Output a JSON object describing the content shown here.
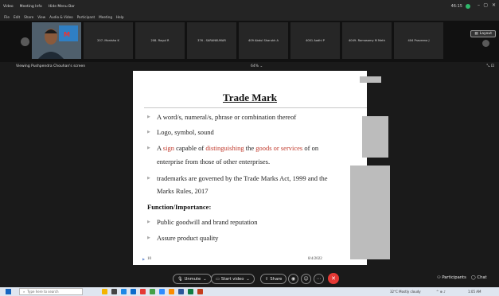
{
  "titlebar": {
    "app_name": "Video",
    "meeting_info": "Meeting Info",
    "hide_menu": "Hide Menu Bar",
    "clock": "46:15",
    "minimize": "–",
    "maximize": "▢",
    "close": "✕"
  },
  "menubar": [
    "File",
    "Edit",
    "Share",
    "View",
    "Audio & Video",
    "Participant",
    "Meeting",
    "Help"
  ],
  "participants": [
    {
      "name": ""
    },
    {
      "name": "207- Monisha K"
    },
    {
      "name": "208- Ragul R"
    },
    {
      "name": "376 - SARANKUMAR"
    },
    {
      "name": "409 Abdul Sharukh A"
    },
    {
      "name": "4001 Aadhi P"
    },
    {
      "name": "4049- Ramasamy M Meth"
    },
    {
      "name": "404 Praveena J"
    }
  ],
  "layout_label": "Layout",
  "viewbar": {
    "viewing_text": "Viewing Pushpendra Chouhan's screen",
    "zoom": "64%"
  },
  "slide": {
    "title": "Trade Mark",
    "bullet1": "A word/s, numeral/s, phrase or combination thereof",
    "bullet2": "Logo, symbol, sound",
    "bullet3": {
      "p1": "A ",
      "sign": "sign",
      "p2": " capable of ",
      "distinguishing": "distinguishing",
      "p3": " the ",
      "goods": "goods or services",
      "p4": " of on",
      "line2": "enterprise from those of other enterprises."
    },
    "bullet4_line1": "trademarks are governed by the Trade Marks Act, 1999 and the",
    "bullet4_line2": "Marks Rules, 2017",
    "heading": "Function/Importance:",
    "bullet5": "Public goodwill and brand reputation",
    "bullet6": "Assure product quality",
    "slide_number": "10",
    "date": "8/4/2022"
  },
  "controls": {
    "unmute": "Unmute",
    "start_video": "Start video",
    "share": "Share",
    "participants": "Participants",
    "chat": "Chat"
  },
  "taskbar": {
    "search_placeholder": "Type here to search",
    "weather": "32°C Mostly cloudy",
    "time": "1:05 AM"
  },
  "colors": {
    "accent_red": "#c0392b",
    "leave_red": "#e53935",
    "rec_green": "#2fb86b"
  }
}
